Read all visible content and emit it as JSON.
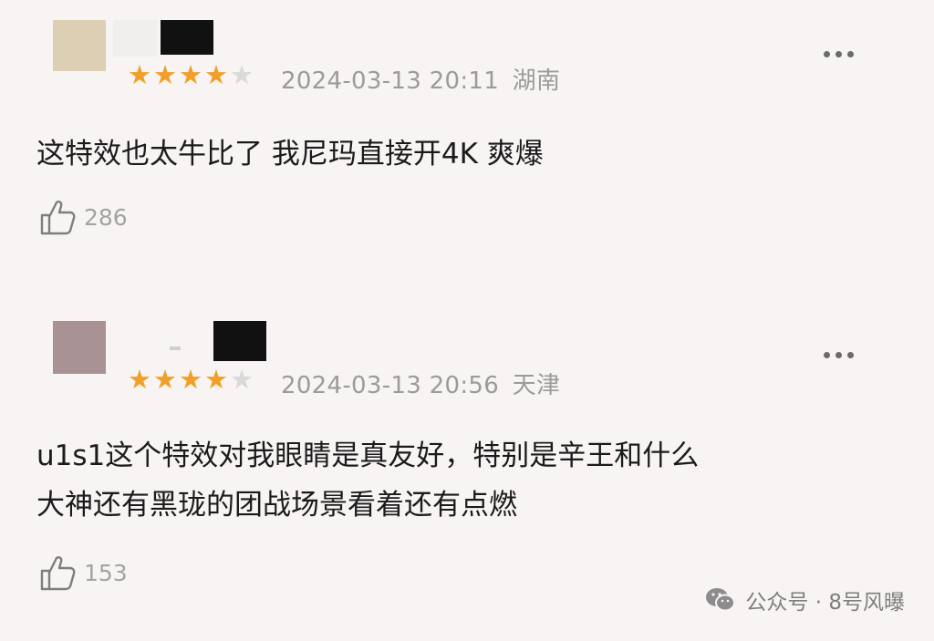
{
  "comments": [
    {
      "rating": 4,
      "max_rating": 5,
      "date": "2024-03-13 20:11",
      "region": "湖南",
      "lines": [
        "这特效也太牛比了 我尼玛直接开4K 爽爆"
      ],
      "likes": "286",
      "avatar_color": "#dccfb4"
    },
    {
      "rating": 4,
      "max_rating": 5,
      "date": "2024-03-13 20:56",
      "region": "天津",
      "lines": [
        "u1s1这个特效对我眼睛是真友好，特别是辛王和什么",
        "大神还有黑珑的团战场景看着还有点燃"
      ],
      "likes": "153",
      "avatar_color": "#a89294"
    }
  ],
  "watermark": {
    "text": "公众号 · 8号风曝",
    "icon": "wechat-icon"
  },
  "icons": {
    "more": "more-options-icon",
    "like": "thumbs-up-icon",
    "star": "star-icon"
  },
  "colors": {
    "background": "#f7f4f3",
    "star_filled": "#f0a028",
    "star_empty": "#d9d9d9",
    "meta_text": "#9c9a9a"
  }
}
